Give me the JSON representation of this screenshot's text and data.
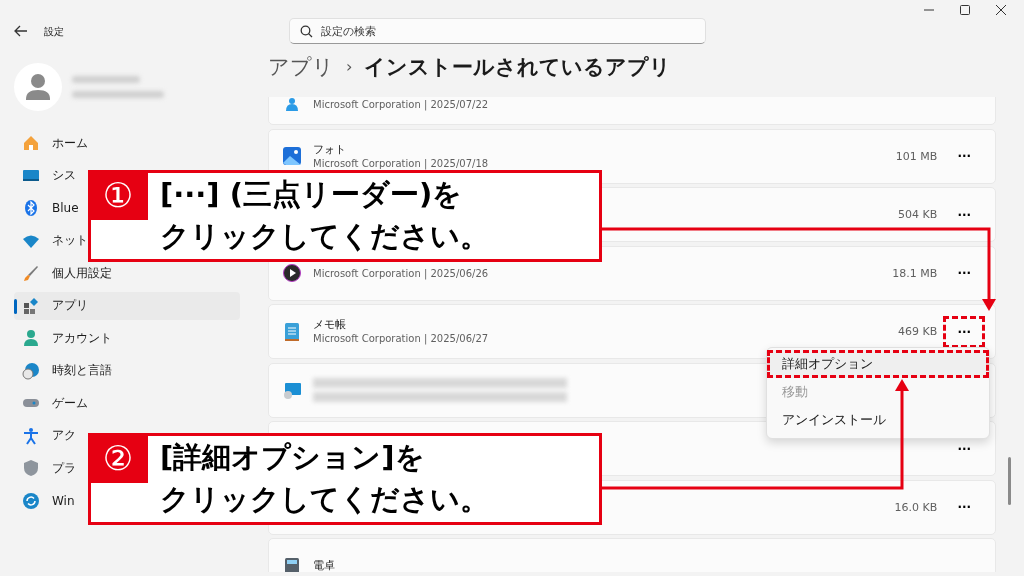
{
  "window": {
    "title": "設定",
    "search_placeholder": "設定の検索"
  },
  "sidebar": {
    "items": [
      {
        "label": "ホーム",
        "selected": false
      },
      {
        "label": "シス",
        "selected": false
      },
      {
        "label": "Blue",
        "selected": false
      },
      {
        "label": "ネット",
        "selected": false
      },
      {
        "label": "個人用設定",
        "selected": false
      },
      {
        "label": "アプリ",
        "selected": true
      },
      {
        "label": "アカウント",
        "selected": false
      },
      {
        "label": "時刻と言語",
        "selected": false
      },
      {
        "label": "ゲーム",
        "selected": false
      },
      {
        "label": "アク",
        "selected": false
      },
      {
        "label": "プラ",
        "selected": false
      },
      {
        "label": "Win",
        "selected": false
      }
    ]
  },
  "breadcrumb": {
    "parent": "アプリ",
    "separator": "›",
    "current": "インストールされているアプリ"
  },
  "apps": [
    {
      "kind": "app",
      "details": "Microsoft Corporation | 2025/07/22",
      "marked": false
    },
    {
      "kind": "app",
      "name": "フォト",
      "details": "Microsoft Corporation | 2025/07/18",
      "size": "101 MB",
      "more": "···",
      "marked": false
    },
    {
      "kind": "app",
      "size": "504 KB",
      "more": "···",
      "marked": false
    },
    {
      "kind": "app",
      "details": "Microsoft Corporation | 2025/06/26",
      "size": "18.1 MB",
      "more": "···",
      "marked": false
    },
    {
      "kind": "app",
      "name": "メモ帳",
      "details": "Microsoft Corporation | 2025/06/27",
      "size": "469 KB",
      "more": "···",
      "marked": true
    },
    {
      "kind": "blurred",
      "marked": false
    },
    {
      "kind": "app",
      "more": "···",
      "marked": false
    },
    {
      "kind": "app",
      "size": "16.0 KB",
      "more": "···",
      "marked": false
    },
    {
      "kind": "app",
      "name": "電卓",
      "marked": false
    }
  ],
  "context_menu": {
    "items": [
      {
        "label": "詳細オプション",
        "disabled": false,
        "marked": true
      },
      {
        "label": "移動",
        "disabled": true,
        "marked": false
      },
      {
        "label": "アンインストール",
        "disabled": false,
        "marked": false
      }
    ]
  },
  "callouts": [
    {
      "number": "①",
      "lines": [
        "[···] (三点リーダー)を",
        "クリックしてください。"
      ]
    },
    {
      "number": "②",
      "lines": [
        "[詳細オプション]を",
        "クリックしてください。"
      ]
    }
  ]
}
